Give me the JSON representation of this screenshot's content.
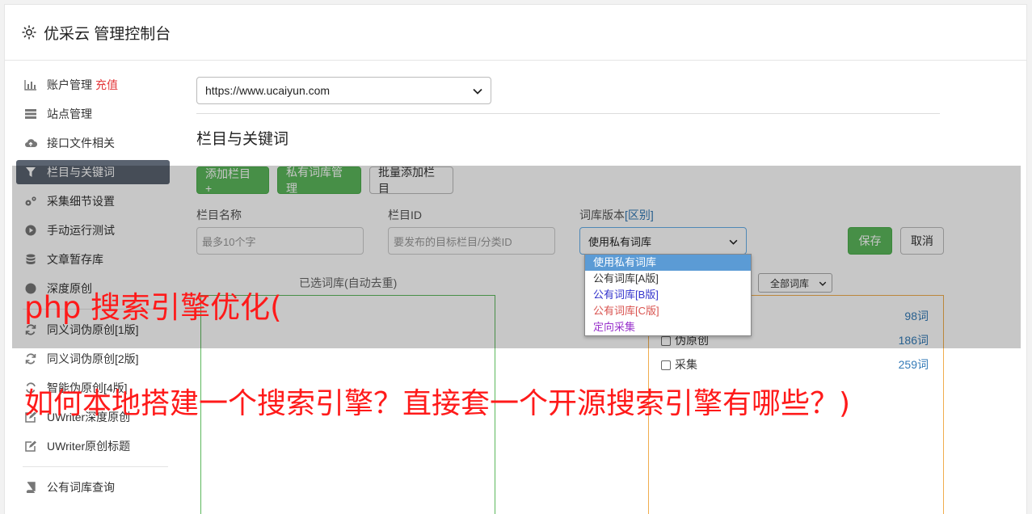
{
  "header": {
    "title": "优采云 管理控制台",
    "icon": "gear-icon"
  },
  "sidebar": {
    "items": [
      {
        "label": "账户管理",
        "extra": "充值",
        "icon": "bar-chart-icon"
      },
      {
        "label": "站点管理",
        "icon": "server-icon"
      },
      {
        "label": "接口文件相关",
        "icon": "cloud-upload-icon"
      },
      {
        "label": "栏目与关键词",
        "icon": "filter-icon",
        "active": true
      },
      {
        "label": "采集细节设置",
        "icon": "gears-icon"
      },
      {
        "label": "手动运行测试",
        "icon": "play-icon"
      },
      {
        "label": "文章暂存库",
        "icon": "database-icon"
      },
      {
        "label": "深度原创",
        "icon": "edit-icon"
      }
    ],
    "items2": [
      {
        "label": "同义词伪原创[1版]",
        "icon": "refresh-icon"
      },
      {
        "label": "同义词伪原创[2版]",
        "icon": "refresh-icon"
      },
      {
        "label": "智能伪原创[4版]",
        "icon": "refresh-icon"
      },
      {
        "label": "UWriter深度原创",
        "icon": "edit-icon"
      },
      {
        "label": "UWriter原创标题",
        "icon": "edit-icon"
      }
    ],
    "items3": [
      {
        "label": "公有词库查询",
        "icon": "book-icon"
      }
    ]
  },
  "main": {
    "site_select": "https://www.ucaiyun.com",
    "section_title": "栏目与关键词",
    "buttons": {
      "add_column": "添加栏目 +",
      "private_lib": "私有词库管理",
      "batch_add": "批量添加栏目"
    },
    "form": {
      "name_label": "栏目名称",
      "name_placeholder": "最多10个字",
      "id_label": "栏目ID",
      "id_placeholder": "要发布的目标栏目/分类ID",
      "version_label": "词库版本",
      "version_link": "[区别]",
      "version_value": "使用私有词库",
      "save": "保存",
      "cancel": "取消"
    },
    "dropdown_options": [
      {
        "label": "使用私有词库",
        "color": "#ffffff",
        "selected": true
      },
      {
        "label": "公有词库[A版]",
        "color": "#333333"
      },
      {
        "label": "公有词库[B版]",
        "color": "#3333cc"
      },
      {
        "label": "公有词库[C版]",
        "color": "#d9534f"
      },
      {
        "label": "定向采集",
        "color": "#9933cc"
      }
    ],
    "chosen_label": "已选词库(自动去重)",
    "all_libs": "全部词库",
    "libraries": [
      {
        "name": "",
        "count": "98词"
      },
      {
        "name": "伪原创",
        "count": "186词"
      },
      {
        "name": "采集",
        "count": "259词"
      }
    ]
  },
  "watermark": {
    "line1": "php 搜索引擎优化(",
    "line2": "如何本地搭建一个搜索引擎？直接套一个开源搜索引擎有哪些？)"
  },
  "colors": {
    "accent_green": "#5cb85c",
    "active_nav": "#5a6370",
    "watermark": "#ff1a1a"
  }
}
